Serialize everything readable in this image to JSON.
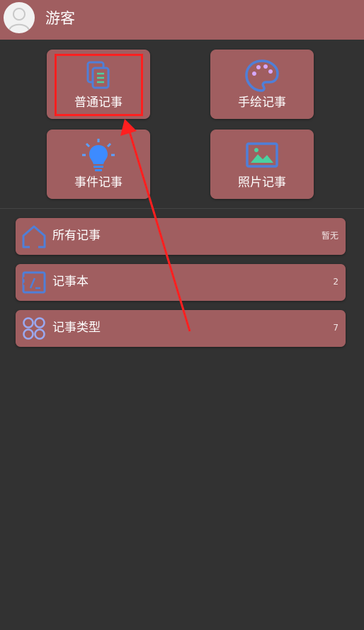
{
  "header": {
    "username": "游客"
  },
  "tiles": [
    {
      "label": "普通记事",
      "icon": "document-icon"
    },
    {
      "label": "手绘记事",
      "icon": "palette-icon"
    },
    {
      "label": "事件记事",
      "icon": "lightbulb-icon"
    },
    {
      "label": "照片记事",
      "icon": "photo-icon"
    }
  ],
  "list": [
    {
      "label": "所有记事",
      "count": "暂无",
      "icon": "home-icon"
    },
    {
      "label": "记事本",
      "count": "2",
      "icon": "notebook-icon"
    },
    {
      "label": "记事类型",
      "count": "7",
      "icon": "category-icon"
    }
  ],
  "colors": {
    "background": "#323232",
    "card": "#a05e60",
    "icon_blue": "#4f7fd8",
    "highlight": "#ff1f1f"
  }
}
